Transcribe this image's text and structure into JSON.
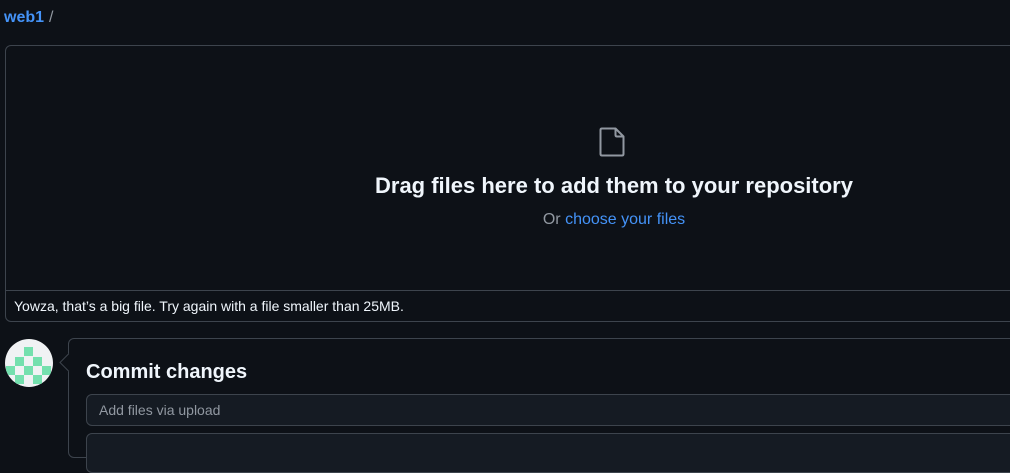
{
  "breadcrumb": {
    "repo": "web1",
    "separator": "/"
  },
  "dropzone": {
    "icon": "file-icon",
    "title": "Drag files here to add them to your repository",
    "subtitle_prefix": "Or",
    "subtitle_link": "choose your files",
    "error_message": "Yowza, that’s a big file. Try again with a file smaller than 25MB."
  },
  "commit": {
    "title": "Commit changes",
    "summary_placeholder": "Add files via upload",
    "summary_value": ""
  },
  "colors": {
    "background": "#0d1117",
    "link": "#4493f8",
    "border": "#3d444d",
    "avatar_accent": "#74e0ae"
  }
}
